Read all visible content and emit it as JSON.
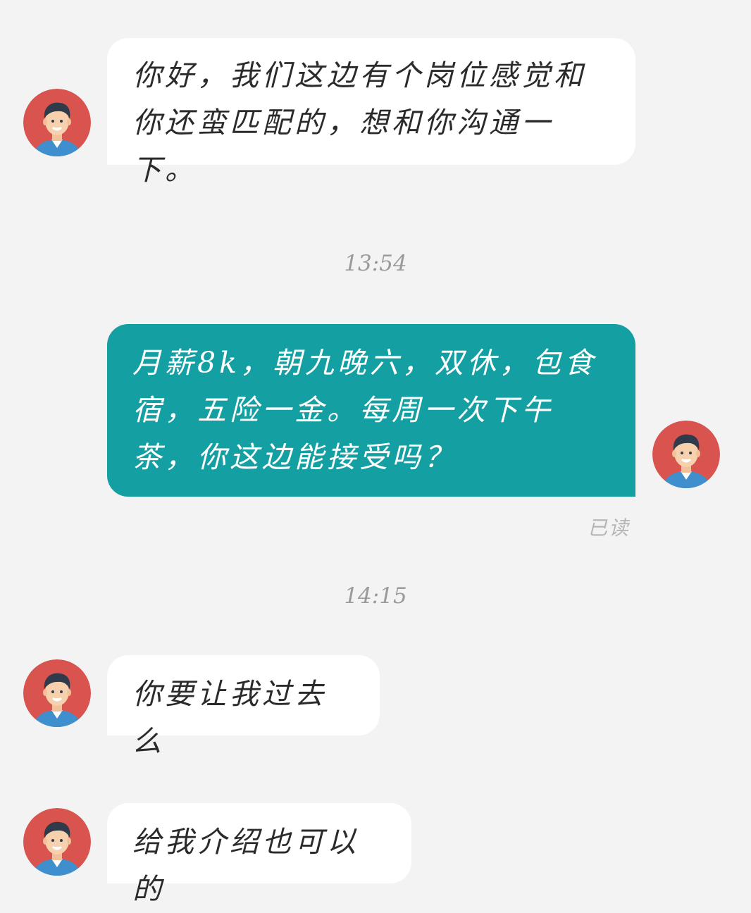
{
  "messages": [
    {
      "sender": "recruiter",
      "text": "你好，我们这边有个岗位感觉和你还蛮匹配的，想和你沟通一下。"
    },
    {
      "sender": "self",
      "text": "月薪8k，朝九晚六，双休，包食宿，五险一金。每周一次下午茶，你这边能接受吗？"
    },
    {
      "sender": "recruiter",
      "text": "你要让我过去么"
    },
    {
      "sender": "recruiter",
      "text": "给我介绍也可以的"
    }
  ],
  "timestamps": [
    "13:54",
    "14:15"
  ],
  "read_status": "已读",
  "colors": {
    "background": "#f3f3f3",
    "incoming_bubble": "#ffffff",
    "outgoing_bubble": "#14a0a3",
    "avatar_bg": "#d9534f"
  }
}
